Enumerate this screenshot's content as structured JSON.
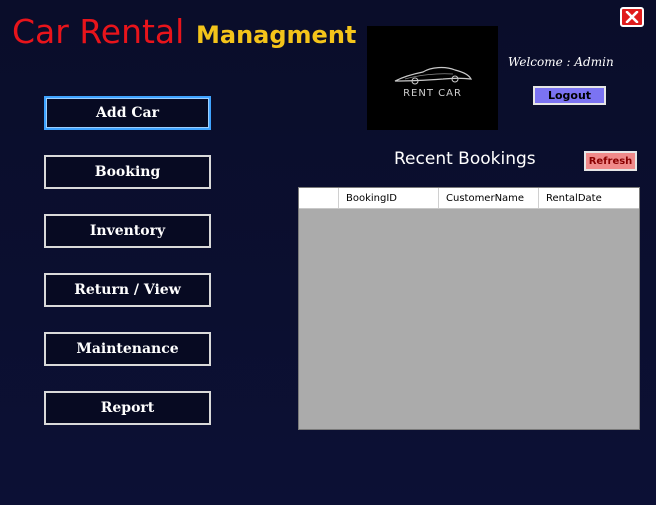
{
  "app": {
    "title_part1": "Car Rental",
    "title_part2": "Managment"
  },
  "header": {
    "logo_text": "RENT CAR",
    "welcome": "Welcome : Admin",
    "logout_label": "Logout",
    "close_icon": "close-icon"
  },
  "nav": {
    "items": [
      {
        "label": "Add Car"
      },
      {
        "label": "Booking"
      },
      {
        "label": "Inventory"
      },
      {
        "label": "Return / View"
      },
      {
        "label": "Maintenance"
      },
      {
        "label": "Report"
      }
    ]
  },
  "bookings": {
    "title": "Recent Bookings",
    "refresh_label": "Refresh",
    "columns": [
      "BookingID",
      "CustomerName",
      "RentalDate"
    ],
    "rows": []
  },
  "colors": {
    "background": "#0b0f30",
    "title_red": "#e8141b",
    "title_yellow": "#f4c41a",
    "logout": "#7b73f2",
    "refresh": "#f08a8a",
    "grid_empty": "#ababab"
  }
}
